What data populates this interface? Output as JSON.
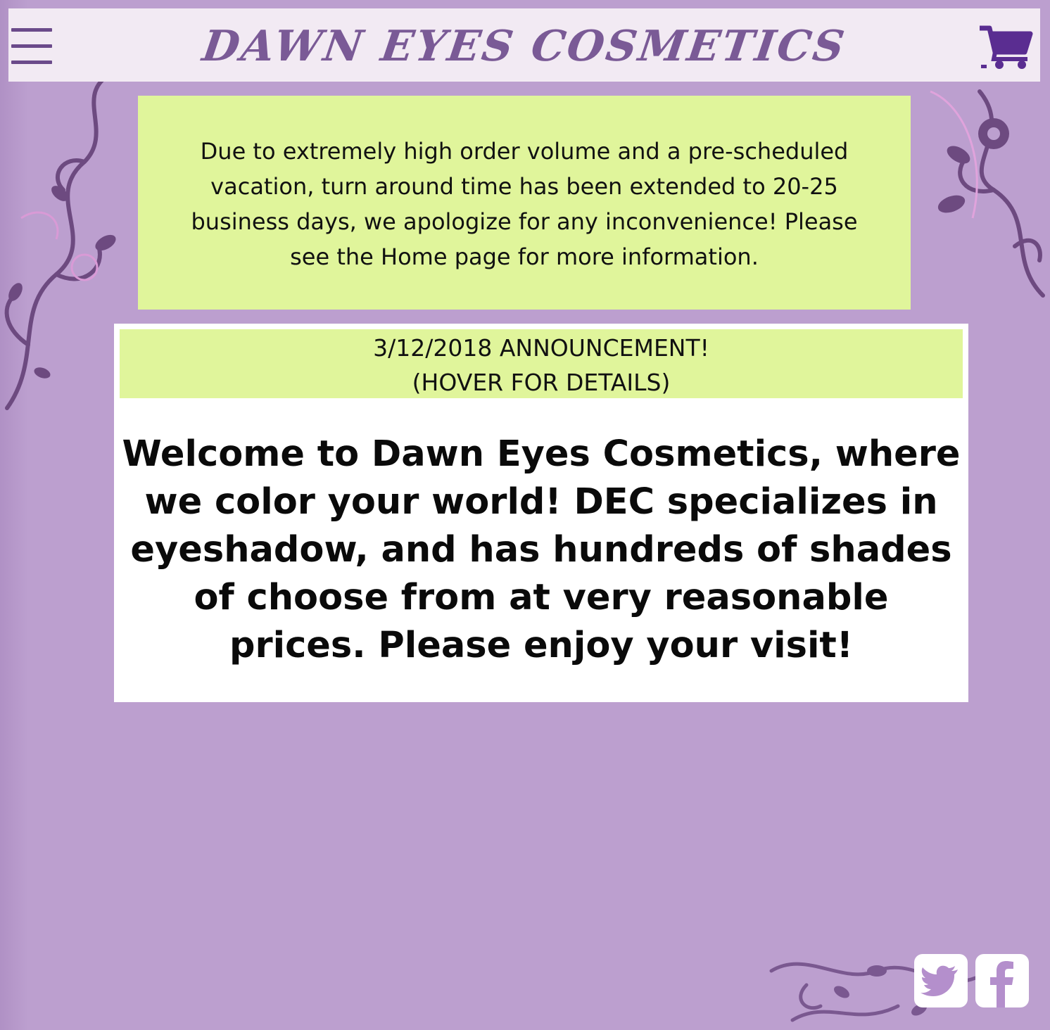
{
  "header": {
    "title": "DAWN EYES COSMETICS",
    "menu_icon": "hamburger-menu-icon",
    "cart_icon": "shopping-cart-icon",
    "accent_color": "#7a5a96",
    "cart_color": "#5a2d91"
  },
  "notice": {
    "text": "Due to extremely high order volume and a pre-scheduled vacation, turn around time has been extended to 20-25 business days, we apologize for any inconvenience! Please see the Home page for more information.",
    "background_color": "#e0f59b"
  },
  "announcement": {
    "line1": "3/12/2018 ANNOUNCEMENT!",
    "line2": "(HOVER FOR DETAILS)"
  },
  "welcome": {
    "text": "Welcome to Dawn Eyes Cosmetics, where we color your world! DEC specializes in eyeshadow, and has hundreds of shades of choose from at very reasonable prices. Please enjoy your visit!"
  },
  "social": {
    "twitter_icon": "twitter-icon",
    "facebook_icon": "facebook-icon"
  },
  "page": {
    "background_color": "#bc9fcf"
  }
}
